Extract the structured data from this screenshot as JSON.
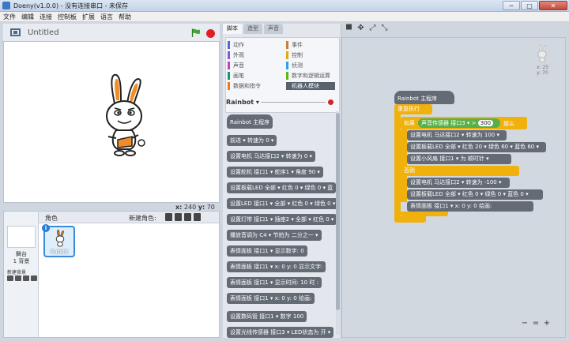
{
  "window": {
    "title": "Doeny(v1.0.0) - 没有连接串口 - 未保存",
    "controls": [
      "─",
      "□",
      "✕"
    ]
  },
  "menu": [
    "文件",
    "编辑",
    "连接",
    "控制板",
    "扩展",
    "语言",
    "帮助"
  ],
  "stage": {
    "project_title": "Untitled",
    "coords_x_label": "x:",
    "coords_x": "240",
    "coords_y_label": "y:",
    "coords_y": "70"
  },
  "sprites_pane": {
    "stage_label": "舞台",
    "stage_sub": "1 背景",
    "new_backdrop_label": "新建背景",
    "roles_label": "角色",
    "new_sprite_label": "新建角色:",
    "sprite_name": "Rabbit",
    "sprite_badge": "i"
  },
  "tabs": [
    "脚本",
    "造型",
    "声音"
  ],
  "categories": [
    {
      "label": "动作",
      "color": "#4a6cd4"
    },
    {
      "label": "事件",
      "color": "#c88330"
    },
    {
      "label": "外观",
      "color": "#8a55d7"
    },
    {
      "label": "控制",
      "color": "#e1a91a"
    },
    {
      "label": "声音",
      "color": "#bb42c3"
    },
    {
      "label": "侦测",
      "color": "#2ca5e2"
    },
    {
      "label": "画笔",
      "color": "#0e9a6c"
    },
    {
      "label": "数字和逻辑运算",
      "color": "#5cb712"
    },
    {
      "label": "数据和指令",
      "color": "#ee7d16"
    },
    {
      "label": "机器人模块",
      "color": "#58616e"
    }
  ],
  "palette": {
    "section_label": "Rainbot ▾",
    "blocks": [
      "Rainbot 主程序",
      "前进 ▾  转速为  0 ▾",
      "设置电机  马达接口2 ▾  转速为  0 ▾",
      "设置舵机  接口1 ▾  舵序1 ▾  角度  90 ▾",
      "设置板载LED  全部 ▾  红色  0 ▾  绿色  0 ▾  蓝",
      "设置LED  接口1 ▾  全部 ▾  红色  0 ▾  绿色  0 ▾",
      "设置灯带  接口1 ▾  插座2 ▾  全部 ▾  红色  0 ▾",
      "播放音调为  C4 ▾  节拍为  二分之一 ▾",
      "表情面板  接口1 ▾  显示数字:  0",
      "表情面板  接口1 ▾  x:  0  y:  0  显示文字:",
      "表情面板  接口1 ▾  显示时间:  10  时  :",
      "表情面板  接口1 ▾  x:  0  y:  0  绘画:",
      "设置数码管  接口1 ▾  数字  100",
      "设置光线传感器  接口3 ▾  LED状态为  开 ▾"
    ]
  },
  "script": {
    "hat": "Rainbot 主程序",
    "forever": "重复执行",
    "if_label": "如果",
    "condition_sensor": "声音传感器  接口3 ▾",
    "condition_op": ">",
    "condition_value": "300",
    "then_label": "那么",
    "else_label": "否则",
    "then_blocks": [
      "设置电机  马达接口2 ▾  转速为  100 ▾",
      "设置板载LED  全部 ▾  红色  20 ▾  绿色  60 ▾  蓝色  60 ▾",
      "设置小风扇  接口1 ▾  为  顺时针 ▾"
    ],
    "else_blocks": [
      "设置电机  马达接口2 ▾  转速为  -100 ▾",
      "设置板载LED  全部 ▾  红色  0 ▾  绿色  0 ▾  蓝色  0 ▾",
      "表情面板  接口1 ▾  x:  0  y:  0  绘画:"
    ],
    "sprite_x": "x: 25",
    "sprite_y": "y: 70"
  },
  "zoom": [
    "−",
    "=",
    "+"
  ],
  "colors": {
    "block_gray": "#646b75",
    "control_yellow": "#f1b10d",
    "operator_green": "#58b04a",
    "stop_red": "#e02020"
  }
}
